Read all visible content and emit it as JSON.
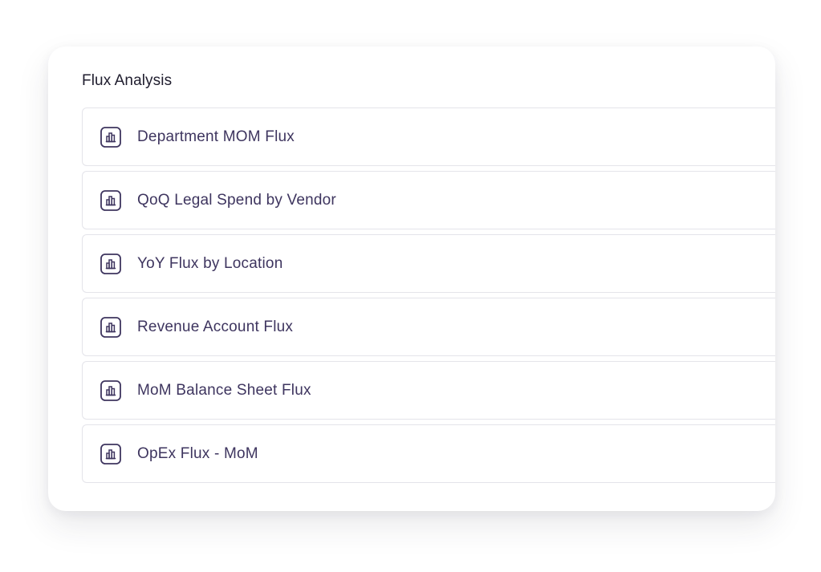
{
  "section": {
    "title": "Flux Analysis"
  },
  "reports": [
    {
      "label": "Department MOM Flux",
      "icon": "bar-chart-icon"
    },
    {
      "label": "QoQ Legal Spend by Vendor",
      "icon": "bar-chart-icon"
    },
    {
      "label": "YoY Flux by Location",
      "icon": "bar-chart-icon"
    },
    {
      "label": "Revenue Account Flux",
      "icon": "bar-chart-icon"
    },
    {
      "label": "MoM Balance Sheet Flux",
      "icon": "bar-chart-icon"
    },
    {
      "label": "OpEx Flux - MoM",
      "icon": "bar-chart-icon"
    }
  ],
  "colors": {
    "text_primary": "#1f1d2e",
    "item_text": "#3e355f",
    "icon_stroke": "#3e355f",
    "border": "#e4e4ea"
  }
}
